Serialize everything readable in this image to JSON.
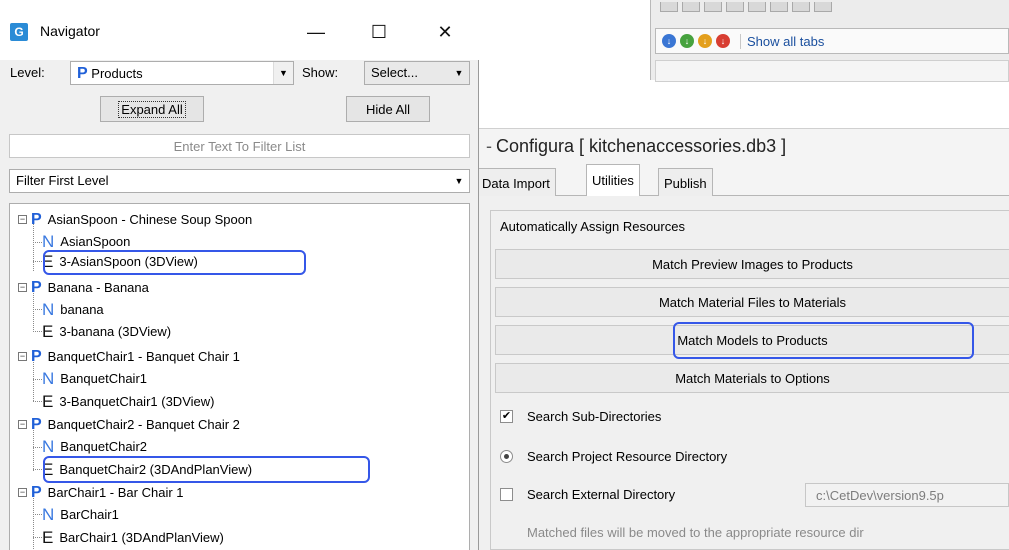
{
  "background_app": {
    "show_all_tabs": "Show all tabs",
    "config_title": "Configura [ kitchenaccessories.db3 ]",
    "tabs": [
      "Data Import",
      "Utilities",
      "Publish"
    ],
    "active_tab": "Utilities",
    "group_title": "Automatically Assign Resources",
    "buttons": [
      "Match Preview Images to Products",
      "Match Material Files to Materials",
      "Match Models to Products",
      "Match Materials to Options"
    ],
    "search_sub_dirs": "Search Sub-Directories",
    "search_project": "Search Project Resource Directory",
    "search_external": "Search External Directory",
    "external_path": "c:\\CetDev\\version9.5p",
    "note": "Matched files will be moved to the appropriate resource dir"
  },
  "navigator": {
    "title": "Navigator",
    "level_label": "Level:",
    "level_value": "Products",
    "show_label": "Show:",
    "show_value": "Select...",
    "expand_all": "Expand All",
    "hide_all": "Hide All",
    "filter_placeholder": "Enter Text To Filter List",
    "filter_first_level": "Filter First Level",
    "tree": [
      {
        "type": "P",
        "label": "AsianSpoon - Chinese Soup Spoon",
        "expander": "⊟"
      },
      {
        "type": "N",
        "label": "AsianSpoon"
      },
      {
        "type": "E",
        "label": "3-AsianSpoon (3DView)"
      },
      {
        "type": "P",
        "label": "Banana - Banana",
        "expander": "⊟"
      },
      {
        "type": "N",
        "label": "banana"
      },
      {
        "type": "E",
        "label": "3-banana (3DView)"
      },
      {
        "type": "P",
        "label": "BanquetChair1 - Banquet Chair 1",
        "expander": "⊟"
      },
      {
        "type": "N",
        "label": "BanquetChair1"
      },
      {
        "type": "E",
        "label": "3-BanquetChair1 (3DView)"
      },
      {
        "type": "P",
        "label": "BanquetChair2 - Banquet Chair 2",
        "expander": "⊟"
      },
      {
        "type": "N",
        "label": "BanquetChair2"
      },
      {
        "type": "E",
        "label": "BanquetChair2 (3DAndPlanView)"
      },
      {
        "type": "P",
        "label": "BarChair1 - Bar Chair 1",
        "expander": "⊟"
      },
      {
        "type": "N",
        "label": "BarChair1"
      },
      {
        "type": "E",
        "label": "BarChair1 (3DAndPlanView)"
      }
    ]
  },
  "colors": {
    "highlight": "#3557e8",
    "product_glyph": "#2060d8"
  }
}
